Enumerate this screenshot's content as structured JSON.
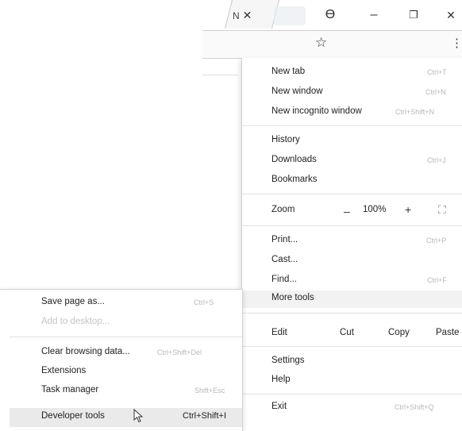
{
  "tabs": {
    "active_label": "N",
    "close_glyph": "✕"
  },
  "window_controls": {
    "profile_icon": "ϴ",
    "minimize": "–",
    "restore": "❐",
    "close": "✕"
  },
  "toolbar": {
    "star_icon": "☆",
    "menu_icon": "⋮"
  },
  "main_menu": {
    "new_tab": {
      "label": "New tab",
      "shortcut": "Ctrl+T"
    },
    "new_window": {
      "label": "New window",
      "shortcut": "Ctrl+N"
    },
    "new_incognito": {
      "label": "New incognito window",
      "shortcut": "Ctrl+Shift+N"
    },
    "history": {
      "label": "History"
    },
    "downloads": {
      "label": "Downloads",
      "shortcut": "Ctrl+J"
    },
    "bookmarks": {
      "label": "Bookmarks"
    },
    "zoom": {
      "label": "Zoom",
      "minus": "–",
      "value": "100%",
      "plus": "+",
      "fullscreen": "⛶"
    },
    "print": {
      "label": "Print...",
      "shortcut": "Ctrl+P"
    },
    "cast": {
      "label": "Cast..."
    },
    "find": {
      "label": "Find...",
      "shortcut": "Ctrl+F"
    },
    "more_tools": {
      "label": "More tools"
    },
    "edit": {
      "label": "Edit",
      "cut": "Cut",
      "copy": "Copy",
      "paste": "Paste"
    },
    "settings": {
      "label": "Settings"
    },
    "help": {
      "label": "Help"
    },
    "exit": {
      "label": "Exit",
      "shortcut": "Ctrl+Shift+Q"
    }
  },
  "sub_menu": {
    "save_page": {
      "label": "Save page as...",
      "shortcut": "Ctrl+S"
    },
    "add_to_desktop": {
      "label": "Add to desktop..."
    },
    "clear_browsing": {
      "label": "Clear browsing data...",
      "shortcut": "Ctrl+Shift+Del"
    },
    "extensions": {
      "label": "Extensions"
    },
    "task_manager": {
      "label": "Task manager",
      "shortcut": "Shift+Esc"
    },
    "developer_tools": {
      "label": "Developer tools",
      "shortcut": "Ctrl+Shift+I"
    }
  }
}
